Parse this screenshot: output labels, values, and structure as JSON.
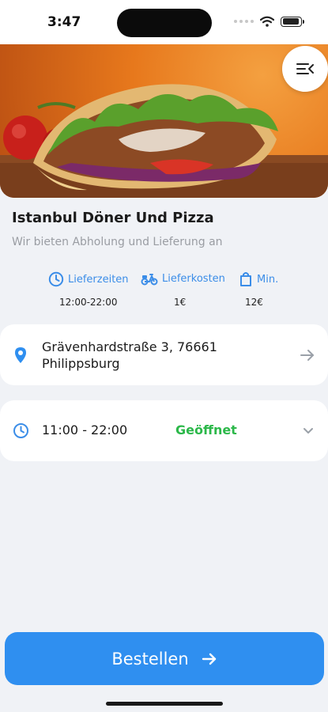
{
  "status_bar": {
    "time": "3:47",
    "icons": [
      "signal-dots-icon",
      "wifi-icon",
      "battery-icon"
    ],
    "battery_level": 0.95
  },
  "hero": {
    "image": "doner-kebab-photo",
    "carousel": {
      "pages": 2,
      "active_index": 0
    }
  },
  "restaurant": {
    "name": "Istanbul Döner Und Pizza",
    "tagline": "Wir bieten Abholung und Lieferung an"
  },
  "info": {
    "delivery_times": {
      "icon": "clock-icon",
      "label": "Lieferzeiten",
      "value": "12:00-22:00"
    },
    "delivery_cost": {
      "icon": "scooter-icon",
      "label": "Lieferkosten",
      "value": "1€"
    },
    "min_order": {
      "icon": "shopping-bag-icon",
      "label": "Min.",
      "value": "12€"
    }
  },
  "address": {
    "icon": "location-pin-icon",
    "line1": "Grävenhardstraße 3, 76661",
    "line2": "Philippsburg",
    "action_icon": "arrow-right-icon"
  },
  "hours": {
    "icon": "clock-icon",
    "text": "11:00 - 22:00",
    "status": "Geöffnet",
    "expand_icon": "chevron-down-icon"
  },
  "order_button": {
    "label": "Bestellen",
    "icon": "arrow-right-icon"
  },
  "colors": {
    "accent": "#2f8ff0",
    "info_blue": "#3b8de8",
    "open_green": "#2cb84a",
    "background": "#f0f2f6",
    "card": "#ffffff"
  }
}
